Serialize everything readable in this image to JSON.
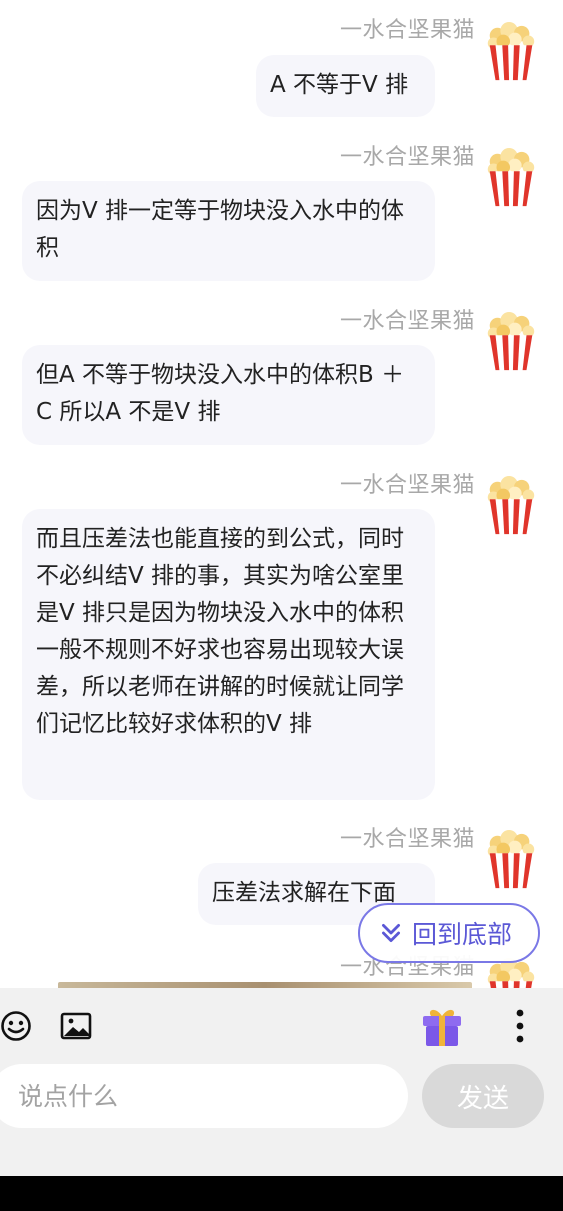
{
  "messages": [
    {
      "sender": "一水合坚果猫",
      "text": "A 不等于V 排"
    },
    {
      "sender": "一水合坚果猫",
      "text": "因为V 排一定等于物块没入水中的体积"
    },
    {
      "sender": "一水合坚果猫",
      "text": "但A 不等于物块没入水中的体积B ＋C 所以A 不是V 排"
    },
    {
      "sender": "一水合坚果猫",
      "text": "而且压差法也能直接的到公式，同时不必纠结V 排的事，其实为啥公室里是V 排只是因为物块没入水中的体积一般不规则不好求也容易出现较大误差，所以老师在讲解的时候就让同学们记忆比较好求体积的V 排"
    },
    {
      "sender": "一水合坚果猫",
      "text": "压差法求解在下面"
    },
    {
      "sender": "一水合坚果猫",
      "text": ""
    }
  ],
  "scroll_to_bottom": {
    "label": "回到底部",
    "icon": "double-chevron-down-icon"
  },
  "toolbar": {
    "emoji_icon": "emoji-icon",
    "image_icon": "image-icon",
    "gift_icon": "gift-icon",
    "more_icon": "more-vertical-icon"
  },
  "input": {
    "placeholder": "说点什么",
    "value": ""
  },
  "send_button": {
    "label": "发送"
  },
  "colors": {
    "accent": "#5b58d6",
    "bubble_bg": "#f6f6fb",
    "sender_name": "#a8a8a8",
    "toolbar_bg": "#f1f1f1",
    "send_disabled": "#d9d9d9"
  }
}
